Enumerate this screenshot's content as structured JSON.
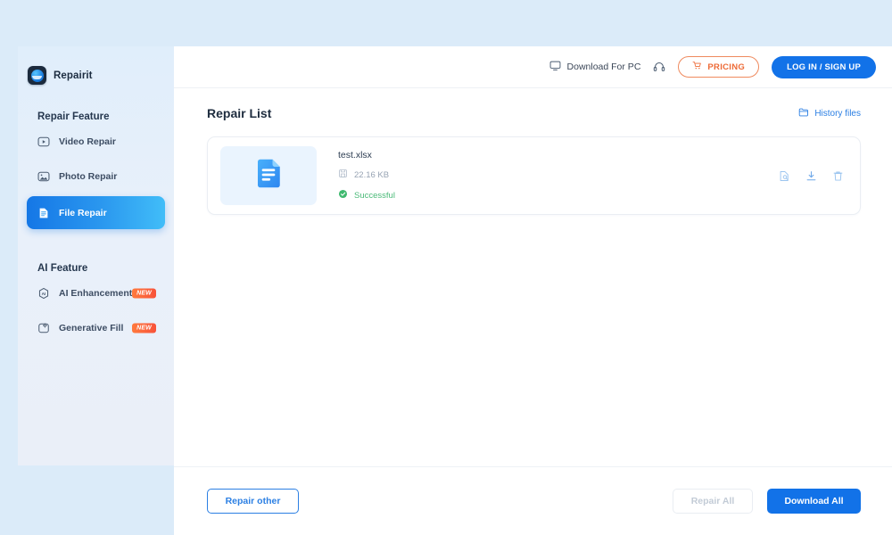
{
  "brand": {
    "name": "Repairit",
    "logo_icon": "repairit-logo-icon"
  },
  "sidebar": {
    "sections": [
      {
        "title": "Repair Feature",
        "items": [
          {
            "label": "Video Repair",
            "icon": "video-play-icon",
            "active": false,
            "badge": ""
          },
          {
            "label": "Photo Repair",
            "icon": "photo-image-icon",
            "active": false,
            "badge": ""
          },
          {
            "label": "File Repair",
            "icon": "document-file-icon",
            "active": true,
            "badge": ""
          }
        ]
      },
      {
        "title": "AI Feature",
        "items": [
          {
            "label": "AI Enhancement",
            "icon": "ai-hexagon-icon",
            "active": false,
            "badge": "NEW"
          },
          {
            "label": "Generative Fill",
            "icon": "generative-fill-icon",
            "active": false,
            "badge": "NEW"
          }
        ]
      }
    ]
  },
  "topbar": {
    "download_pc_label": "Download For PC",
    "download_pc_icon": "monitor-icon",
    "support_icon": "headset-icon",
    "pricing_label": "PRICING",
    "pricing_icon": "shopping-cart-icon",
    "login_label": "LOG IN / SIGN UP"
  },
  "main": {
    "page_title": "Repair List",
    "history_label": "History files",
    "history_icon": "folder-icon",
    "file": {
      "name": "test.xlsx",
      "size": "22.16 KB",
      "size_icon": "file-save-icon",
      "status": "Successful",
      "status_icon": "check-circle-icon",
      "thumb_icon": "xlsx-document-icon",
      "actions": [
        {
          "name": "preview",
          "icon": "file-preview-icon"
        },
        {
          "name": "download",
          "icon": "download-icon"
        },
        {
          "name": "delete",
          "icon": "trash-icon"
        }
      ]
    }
  },
  "footer": {
    "repair_other_label": "Repair other",
    "repair_all_label": "Repair All",
    "download_all_label": "Download All"
  },
  "colors": {
    "page_bg": "#dbebf9",
    "accent_blue": "#1272e8",
    "accent_orange": "#ed6a36",
    "success_green": "#4aba78",
    "badge_new": "#f8523a"
  }
}
